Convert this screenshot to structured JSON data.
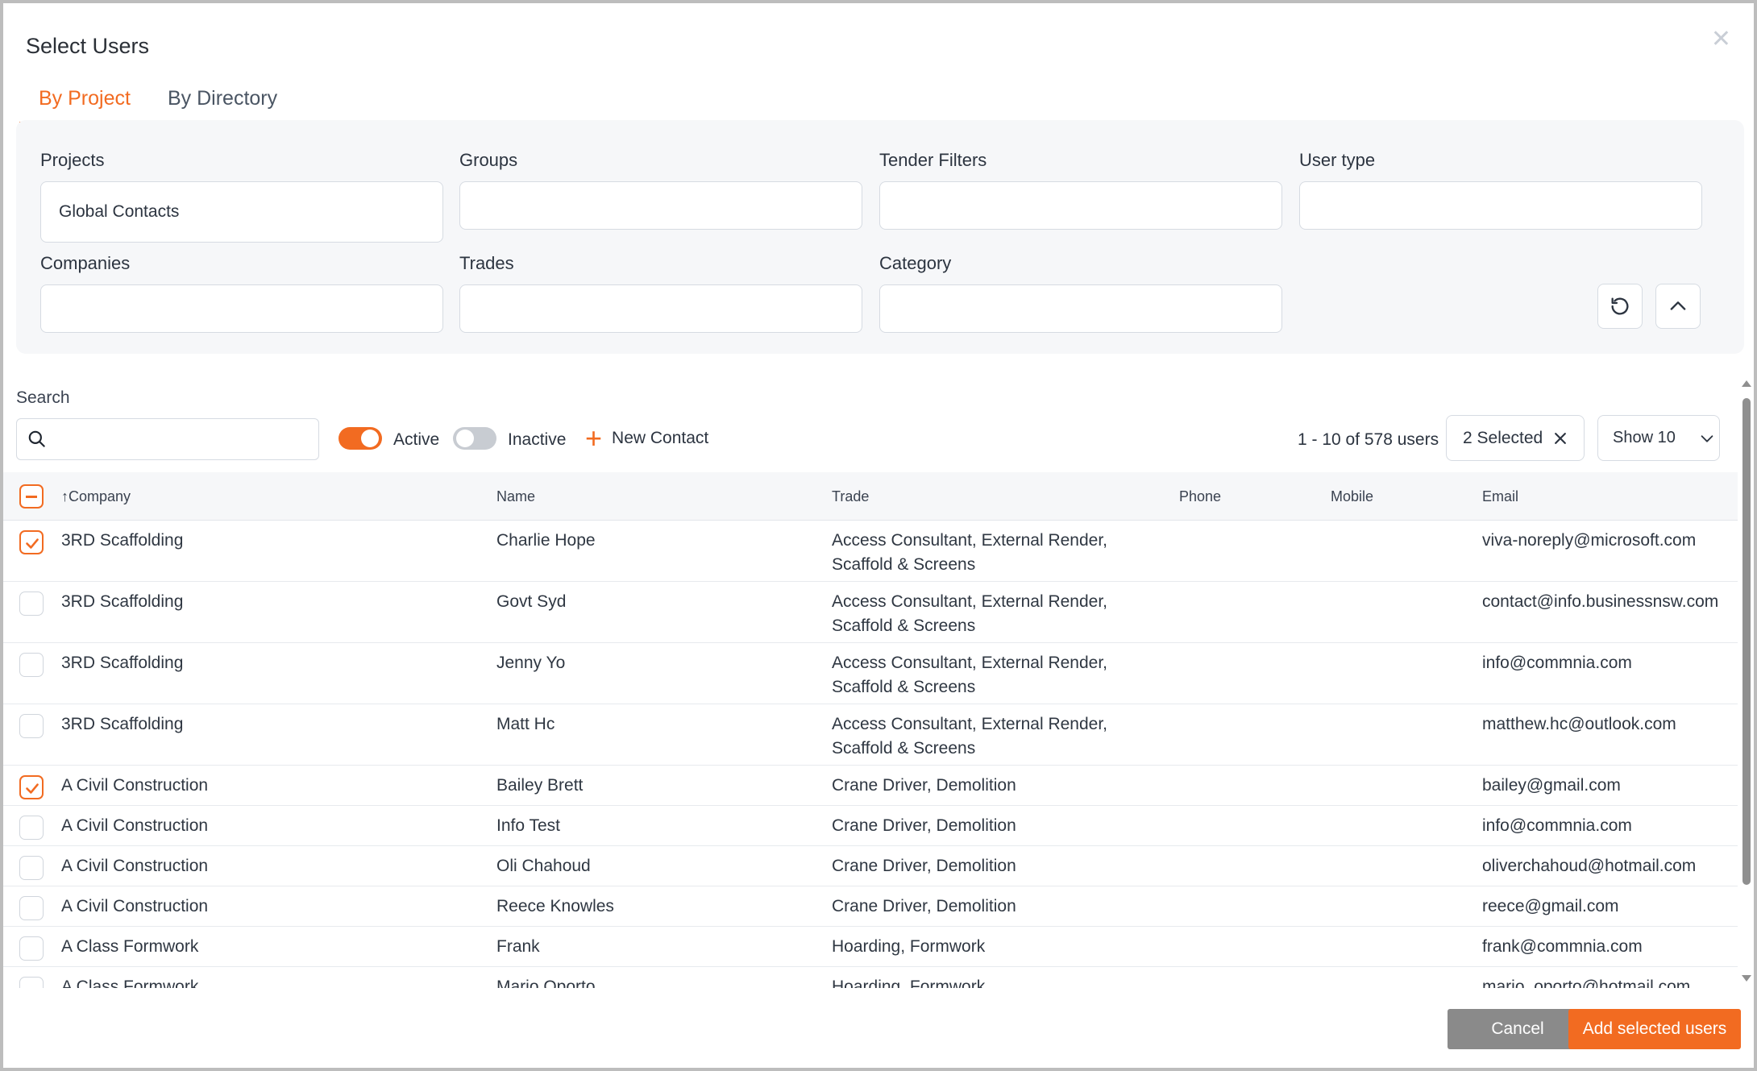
{
  "dialog": {
    "title": "Select Users",
    "close_icon": "close-icon"
  },
  "tabs": [
    {
      "label": "By Project",
      "active": true
    },
    {
      "label": "By Directory",
      "active": false
    }
  ],
  "filters": {
    "projects": {
      "label": "Projects",
      "value": "Global Contacts"
    },
    "groups": {
      "label": "Groups",
      "value": ""
    },
    "tender_filters": {
      "label": "Tender Filters",
      "value": ""
    },
    "user_type": {
      "label": "User type",
      "value": ""
    },
    "companies": {
      "label": "Companies",
      "value": ""
    },
    "trades": {
      "label": "Trades",
      "value": ""
    },
    "category": {
      "label": "Category",
      "value": ""
    },
    "reset_icon": "reset-icon",
    "collapse_icon": "chevron-up-icon"
  },
  "search": {
    "label": "Search",
    "value": "",
    "icon": "search-icon"
  },
  "status": {
    "active": {
      "label": "Active",
      "on": true
    },
    "inactive": {
      "label": "Inactive",
      "on": false
    }
  },
  "new_contact": {
    "label": "New Contact"
  },
  "pagination": {
    "summary": "1 - 10 of 578 users",
    "page_size_label": "Show 10"
  },
  "selection": {
    "label": "2 Selected"
  },
  "table": {
    "columns": {
      "company": "↑Company",
      "name": "Name",
      "trade": "Trade",
      "phone": "Phone",
      "mobile": "Mobile",
      "email": "Email"
    },
    "rows": [
      {
        "checked": true,
        "company": "3RD Scaffolding",
        "name": "Charlie Hope",
        "trade": "Access Consultant, External Render, Scaffold & Screens",
        "phone": "",
        "mobile": "",
        "email": "viva-noreply@microsoft.com"
      },
      {
        "checked": false,
        "company": "3RD Scaffolding",
        "name": "Govt Syd",
        "trade": "Access Consultant, External Render, Scaffold & Screens",
        "phone": "",
        "mobile": "",
        "email": "contact@info.businessnsw.com"
      },
      {
        "checked": false,
        "company": "3RD Scaffolding",
        "name": "Jenny Yo",
        "trade": "Access Consultant, External Render, Scaffold & Screens",
        "phone": "",
        "mobile": "",
        "email": "info@commnia.com"
      },
      {
        "checked": false,
        "company": "3RD Scaffolding",
        "name": "Matt Hc",
        "trade": "Access Consultant, External Render, Scaffold & Screens",
        "phone": "",
        "mobile": "",
        "email": "matthew.hc@outlook.com"
      },
      {
        "checked": true,
        "company": "A Civil Construction",
        "name": "Bailey Brett",
        "trade": "Crane Driver, Demolition",
        "phone": "",
        "mobile": "",
        "email": "bailey@gmail.com"
      },
      {
        "checked": false,
        "company": "A Civil Construction",
        "name": "Info Test",
        "trade": "Crane Driver, Demolition",
        "phone": "",
        "mobile": "",
        "email": "info@commnia.com"
      },
      {
        "checked": false,
        "company": "A Civil Construction",
        "name": "Oli Chahoud",
        "trade": "Crane Driver, Demolition",
        "phone": "",
        "mobile": "",
        "email": "oliverchahoud@hotmail.com"
      },
      {
        "checked": false,
        "company": "A Civil Construction",
        "name": "Reece Knowles",
        "trade": "Crane Driver, Demolition",
        "phone": "",
        "mobile": "",
        "email": "reece@gmail.com"
      },
      {
        "checked": false,
        "company": "A Class Formwork",
        "name": "Frank",
        "trade": "Hoarding, Formwork",
        "phone": "",
        "mobile": "",
        "email": "frank@commnia.com"
      },
      {
        "checked": false,
        "company": "A Class Formwork",
        "name": "Mario Oporto",
        "trade": "Hoarding, Formwork",
        "phone": "",
        "mobile": "",
        "email": "mario_oporto@hotmail.com"
      }
    ]
  },
  "footer": {
    "cancel_label": "Cancel",
    "add_label": "Add selected users"
  },
  "colors": {
    "accent": "#f26b21",
    "cancel": "#8a8a8a",
    "panel": "#f6f7f9"
  }
}
